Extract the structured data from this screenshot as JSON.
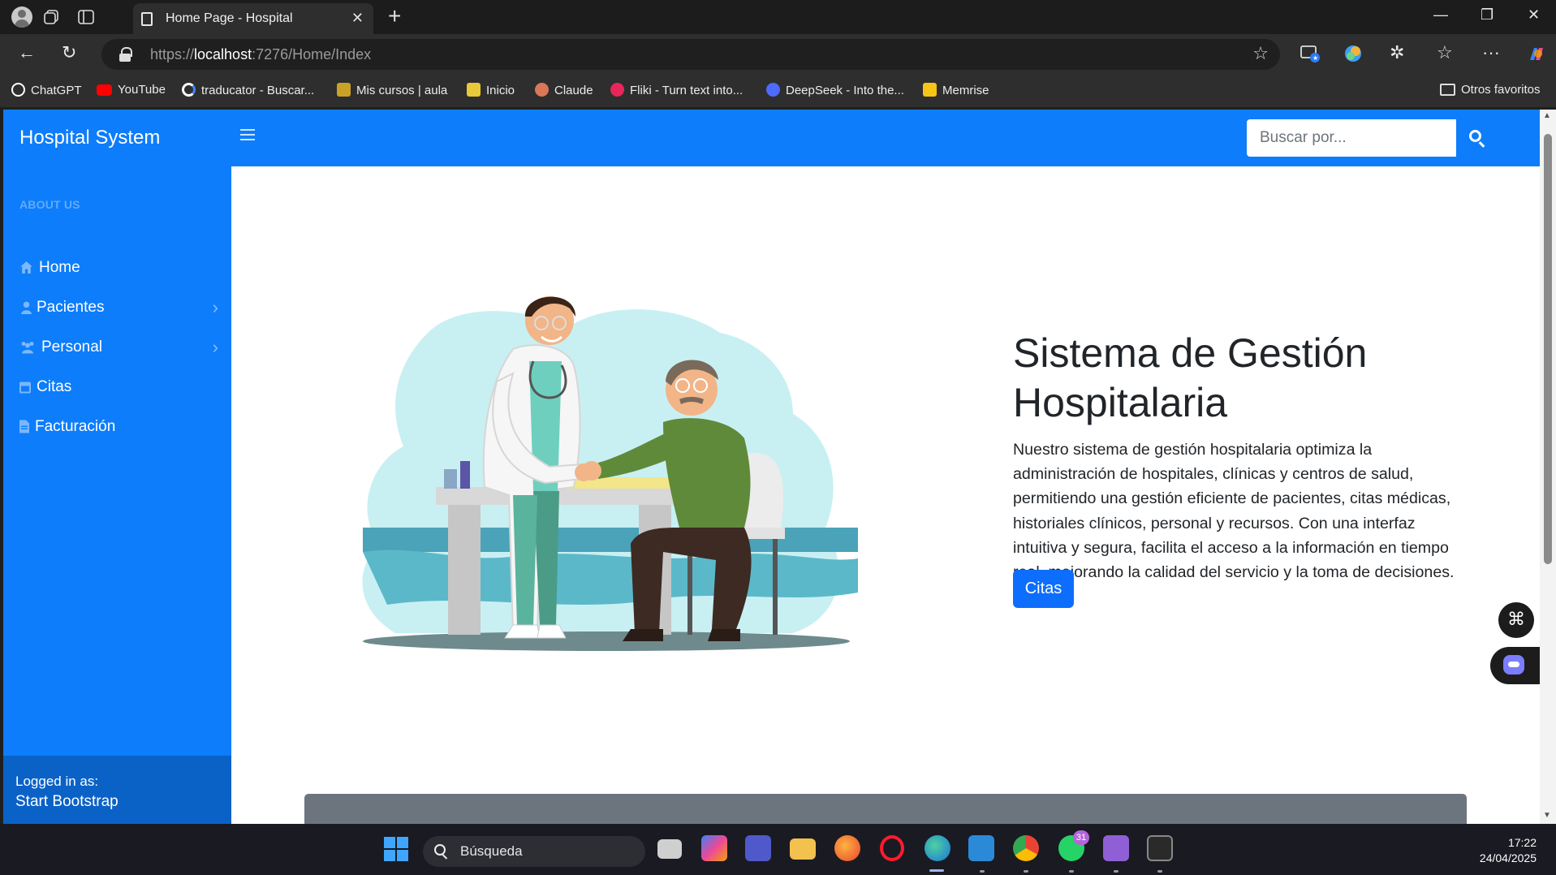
{
  "browser": {
    "tab_title": "Home Page - Hospital",
    "url_prefix": "https://",
    "url_host": "localhost",
    "url_rest": ":7276/Home/Index",
    "bookmarks": [
      {
        "label": "ChatGPT",
        "icon": "chatgpt-icon",
        "color": "#ffffff"
      },
      {
        "label": "YouTube",
        "icon": "youtube-icon",
        "color": "#ff0000"
      },
      {
        "label": "traducator - Buscar...",
        "icon": "google-icon",
        "color": "#ffffff"
      },
      {
        "label": "Mis cursos | aula",
        "icon": "aula-icon",
        "color": "#e0b52e"
      },
      {
        "label": "Inicio",
        "icon": "inicio-icon",
        "color": "#e8c93a"
      },
      {
        "label": "Claude",
        "icon": "claude-icon",
        "color": "#d97757"
      },
      {
        "label": "Fliki - Turn text into...",
        "icon": "fliki-icon",
        "color": "#e8265a"
      },
      {
        "label": "DeepSeek - Into the...",
        "icon": "deepseek-icon",
        "color": "#4d6bfe"
      },
      {
        "label": "Memrise",
        "icon": "memrise-icon",
        "color": "#f5c518"
      }
    ],
    "other_bookmarks": "Otros favoritos"
  },
  "app": {
    "brand": "Hospital System",
    "search_placeholder": "Buscar por..."
  },
  "sidebar": {
    "heading": "ABOUT US",
    "items": [
      {
        "label": "Home",
        "icon": "home-icon",
        "has_submenu": false
      },
      {
        "label": "Pacientes",
        "icon": "users-icon",
        "has_submenu": true
      },
      {
        "label": "Personal",
        "icon": "staff-icon",
        "has_submenu": true
      },
      {
        "label": "Citas",
        "icon": "calendar-icon",
        "has_submenu": false
      },
      {
        "label": "Facturación",
        "icon": "invoice-icon",
        "has_submenu": false
      }
    ],
    "footer_line1": "Logged in as:",
    "footer_line2": "Start Bootstrap"
  },
  "hero": {
    "title": "Sistema de Gestión Hospitalaria",
    "text": "Nuestro sistema de gestión hospitalaria optimiza la administración de hospitales, clínicas y centros de salud, permitiendo una gestión eficiente de pacientes, citas médicas, historiales clínicos, personal y recursos. Con una interfaz intuitiva y segura, facilita el acceso a la información en tiempo real, mejorando la calidad del servicio y la toma de decisiones.",
    "button": "Citas"
  },
  "taskbar": {
    "search": "Búsqueda",
    "time": "17:22",
    "date": "24/04/2025",
    "whatsapp_badge": "31"
  },
  "colors": {
    "primary": "#0d7dfb",
    "button": "#0d6efd",
    "sidebar_footer": "#0a62c7"
  }
}
